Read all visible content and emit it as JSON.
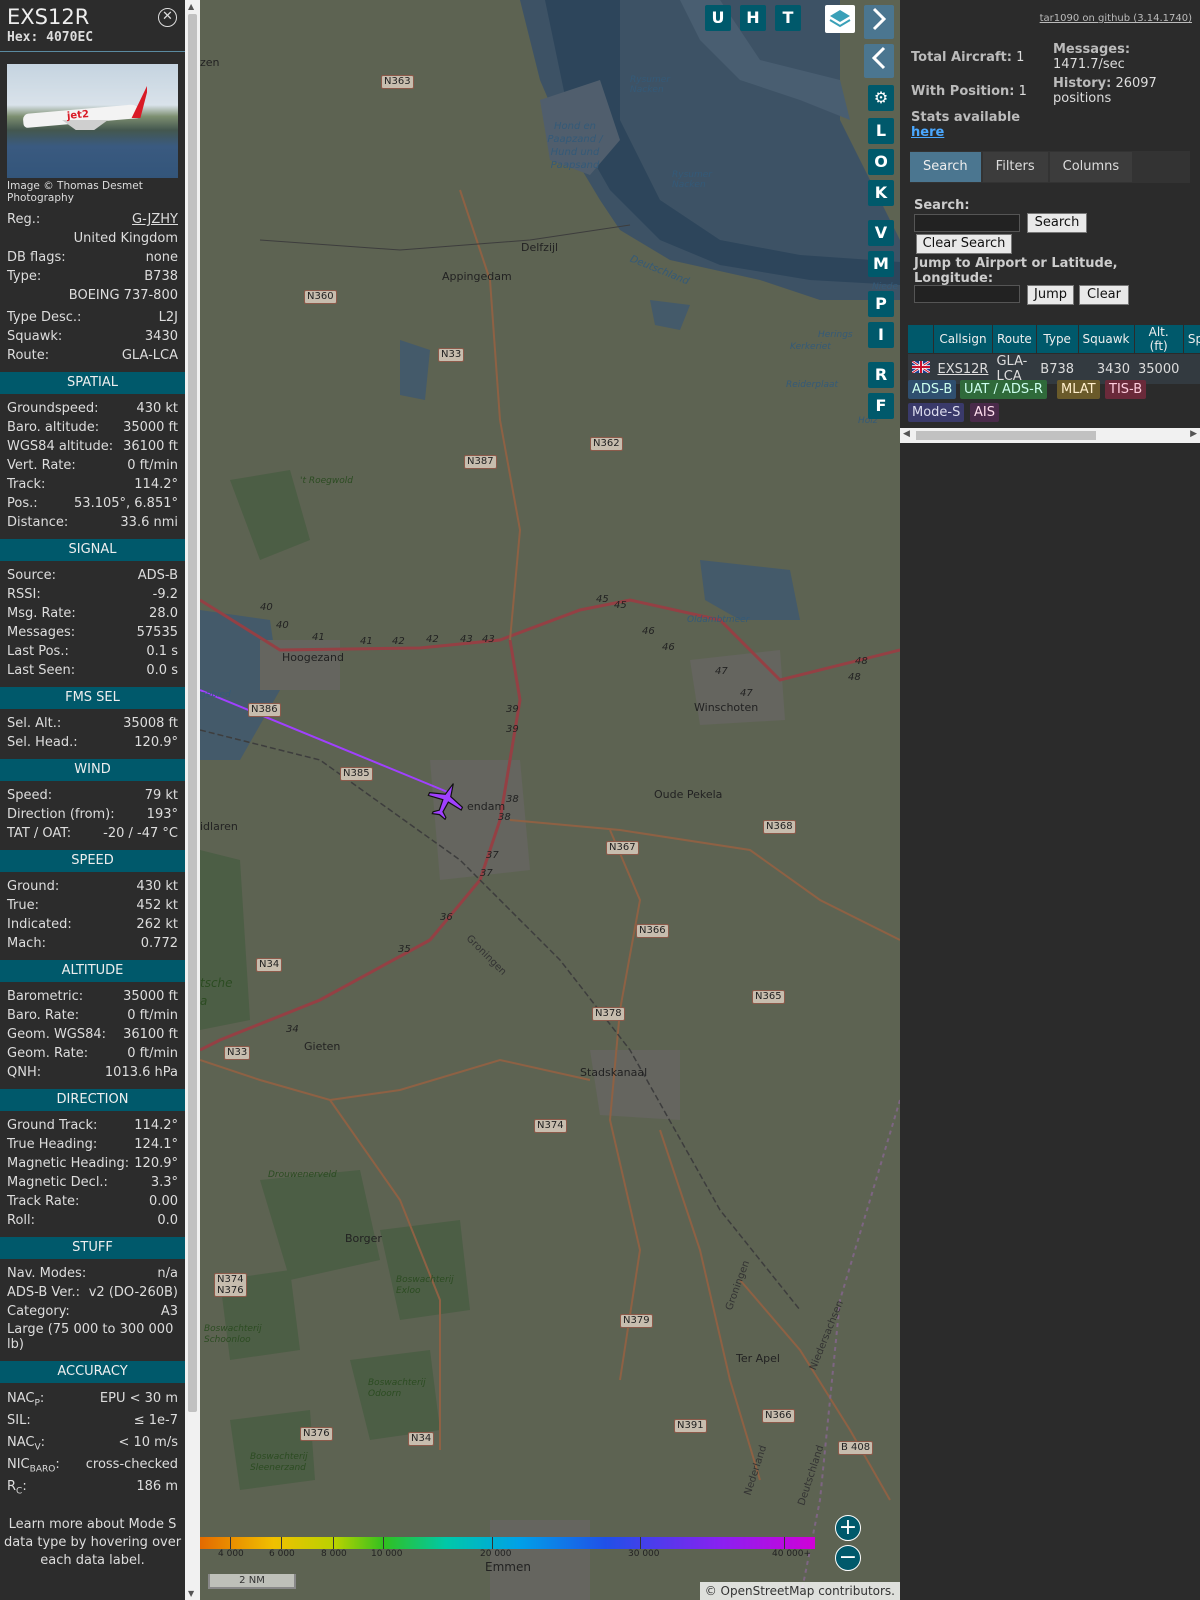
{
  "info": {
    "callsign": "EXS12R",
    "hex": "Hex: 4070EC",
    "photo_credit": "Image © Thomas Desmet Photography",
    "photo_logo": "jet2",
    "reg_label": "Reg.:",
    "reg": "G-JZHY",
    "country": "United Kingdom",
    "dbflags_label": "DB flags:",
    "dbflags": "none",
    "type_label": "Type:",
    "type": "B738",
    "type_full": "BOEING 737-800",
    "typedesc_label": "Type Desc.:",
    "typedesc": "L2J",
    "squawk_label": "Squawk:",
    "squawk": "3430",
    "route_label": "Route:",
    "route": "GLA-LCA",
    "sections": {
      "spatial": "SPATIAL",
      "signal": "SIGNAL",
      "fms": "FMS SEL",
      "wind": "WIND",
      "speed": "SPEED",
      "altitude": "ALTITUDE",
      "direction": "DIRECTION",
      "stuff": "STUFF",
      "accuracy": "ACCURACY"
    },
    "spatial": [
      {
        "k": "Groundspeed:",
        "v": "430 kt"
      },
      {
        "k": "Baro. altitude:",
        "v": "35000 ft"
      },
      {
        "k": "WGS84 altitude:",
        "v": "36100 ft"
      },
      {
        "k": "Vert. Rate:",
        "v": "0 ft/min"
      },
      {
        "k": "Track:",
        "v": "114.2°"
      },
      {
        "k": "Pos.:",
        "v": "53.105°, 6.851°"
      },
      {
        "k": "Distance:",
        "v": "33.6 nmi"
      }
    ],
    "signal": [
      {
        "k": "Source:",
        "v": "ADS-B"
      },
      {
        "k": "RSSI:",
        "v": "-9.2"
      },
      {
        "k": "Msg. Rate:",
        "v": "28.0"
      },
      {
        "k": "Messages:",
        "v": "57535"
      },
      {
        "k": "Last Pos.:",
        "v": "0.1 s"
      },
      {
        "k": "Last Seen:",
        "v": "0.0 s"
      }
    ],
    "fms": [
      {
        "k": "Sel. Alt.:",
        "v": "35008 ft"
      },
      {
        "k": "Sel. Head.:",
        "v": "120.9°"
      }
    ],
    "wind": [
      {
        "k": "Speed:",
        "v": "79 kt"
      },
      {
        "k": "Direction (from):",
        "v": "193°"
      },
      {
        "k": "TAT / OAT:",
        "v": "-20 / -47 °C"
      }
    ],
    "speed": [
      {
        "k": "Ground:",
        "v": "430 kt"
      },
      {
        "k": "True:",
        "v": "452 kt"
      },
      {
        "k": "Indicated:",
        "v": "262 kt"
      },
      {
        "k": "Mach:",
        "v": "0.772"
      }
    ],
    "altitude": [
      {
        "k": "Barometric:",
        "v": "35000 ft"
      },
      {
        "k": "Baro. Rate:",
        "v": "0 ft/min"
      },
      {
        "k": "Geom. WGS84:",
        "v": "36100 ft"
      },
      {
        "k": "Geom. Rate:",
        "v": "0 ft/min"
      },
      {
        "k": "QNH:",
        "v": "1013.6 hPa"
      }
    ],
    "direction": [
      {
        "k": "Ground Track:",
        "v": "114.2°"
      },
      {
        "k": "True Heading:",
        "v": "124.1°"
      },
      {
        "k": "Magnetic Heading:",
        "v": "120.9°"
      },
      {
        "k": "Magnetic Decl.:",
        "v": "3.3°"
      },
      {
        "k": "Track Rate:",
        "v": "0.00"
      },
      {
        "k": "Roll:",
        "v": "0.0"
      }
    ],
    "stuff": [
      {
        "k": "Nav. Modes:",
        "v": "n/a"
      },
      {
        "k": "ADS-B Ver.:",
        "v": "v2 (DO-260B)"
      },
      {
        "k": "Category:",
        "v": "A3"
      }
    ],
    "category_desc": "Large (75 000 to 300 000 lb)",
    "accuracy": {
      "nacp_k": "NAC",
      "nacp_sub": "P",
      "nacp_v": "EPU < 30 m",
      "sil_k": "SIL:",
      "sil_v": "≤ 1e-7",
      "nacv_k": "NAC",
      "nacv_sub": "V",
      "nacv_v": "< 10 m/s",
      "nic_k": "NIC",
      "nic_sub": "BARO",
      "nic_v": "cross-checked",
      "rc_k": "R",
      "rc_sub": "C",
      "rc_v": "186 m"
    },
    "footer": "Learn more about Mode S data type by hovering over each data label."
  },
  "map": {
    "buttons": {
      "u": "U",
      "h": "H",
      "t": "T",
      "l": "L",
      "o": "O",
      "k": "K",
      "v": "V",
      "m": "M",
      "p": "P",
      "i": "I",
      "r": "R",
      "f": "F"
    },
    "places": {
      "delfzijl": "Delfzijl",
      "appingedam": "Appingedam",
      "hoogezand": "Hoogezand",
      "winschoten": "Winschoten",
      "oudepekela": "Oude Pekela",
      "veendam": "endam",
      "gieten": "Gieten",
      "stadskanaal": "Stadskanaal",
      "borger": "Borger",
      "terapel": "Ter Apel",
      "emmen": "Emmen",
      "zuidlaren": "idlaren",
      "zen": "zen",
      "deutschland": "Deutschland",
      "groningen": "Groningen",
      "nederland": "Nederland",
      "niedersachsen": "Niedersachsen",
      "deutschland2": "Deutschland",
      "hond": "Hond en Paapzand / Hund und Paapsand",
      "rysumer": "Rysumer Nacken",
      "rysumer2": "Rysumer Nacken",
      "oldambt": "Oldambtmeer",
      "roegwold": "'t Roegwold",
      "drouwen": "Drouwenerveld",
      "exloo": "Boswachterij Exloo",
      "schoonloo": "Boswachterij Schoonloo",
      "odoorn": "Boswachterij Odoorn",
      "sleen": "Boswachterij Sleenerzand",
      "kerkeriet": "Kerkeriet",
      "reider": "Reiderplaat",
      "herings": "Herings",
      "niede": "Niede",
      "tsche": "tsche",
      "a": "a",
      "gebied": "gebied",
      "holz": "Holz"
    },
    "roads": {
      "n363": "N363",
      "n360": "N360",
      "n33a": "N33",
      "n387": "N387",
      "n362": "N362",
      "n386": "N386",
      "n385": "N385",
      "n367": "N367",
      "n368": "N368",
      "n366a": "N366",
      "n365": "N365",
      "n34a": "N34",
      "n378": "N378",
      "n33b": "N33",
      "n374a": "N374",
      "n374b": "N374\nN376",
      "n379": "N379",
      "n376": "N376",
      "n34b": "N34",
      "n391": "N391",
      "n366b": "N366",
      "b408": "B 408"
    },
    "exits": [
      "40",
      "40",
      "41",
      "41",
      "42",
      "42",
      "43",
      "43",
      "45",
      "45",
      "46",
      "46",
      "47",
      "47",
      "48",
      "48",
      "39",
      "39",
      "38",
      "38",
      "37",
      "37",
      "36",
      "35",
      "34"
    ],
    "legend_ticks": [
      "4 000",
      "6 000",
      "8 000",
      "10 000",
      "20 000",
      "30 000",
      "40 000+"
    ],
    "scale": "2 NM",
    "attribution": "© OpenStreetMap contributors.",
    "zoom_in": "+",
    "zoom_out": "−"
  },
  "right": {
    "github": "tar1090 on github (3.14.1740)",
    "total_label": "Total Aircraft:",
    "total": "1",
    "withpos_label": "With Position:",
    "withpos": "1",
    "stats_label": "Stats available",
    "stats_link": "here",
    "messages_label": "Messages:",
    "messages": "1471.7/sec",
    "history_label": "History:",
    "history": "26097 positions",
    "tabs": [
      "Search",
      "Filters",
      "Columns"
    ],
    "search_label": "Search:",
    "search_btn": "Search",
    "clear_search_btn": "Clear Search",
    "jump_label": "Jump to Airport or Latitude, Longitude:",
    "jump_btn": "Jump",
    "clear_btn": "Clear",
    "columns": [
      "",
      "Callsign",
      "Route",
      "Type",
      "Squawk",
      "Alt. (ft)",
      "Sp"
    ],
    "row": {
      "callsign": "EXS12R",
      "route": "GLA-LCA",
      "type": "B738",
      "squawk": "3430",
      "alt": "35000"
    },
    "sources": [
      "ADS-B",
      "UAT / ADS-R",
      "MLAT",
      "TIS-B",
      "Mode-S",
      "AIS"
    ],
    "colors": {
      "accent": "#00596b",
      "panel": "#2b2b2b",
      "track": "#a040ff"
    }
  }
}
